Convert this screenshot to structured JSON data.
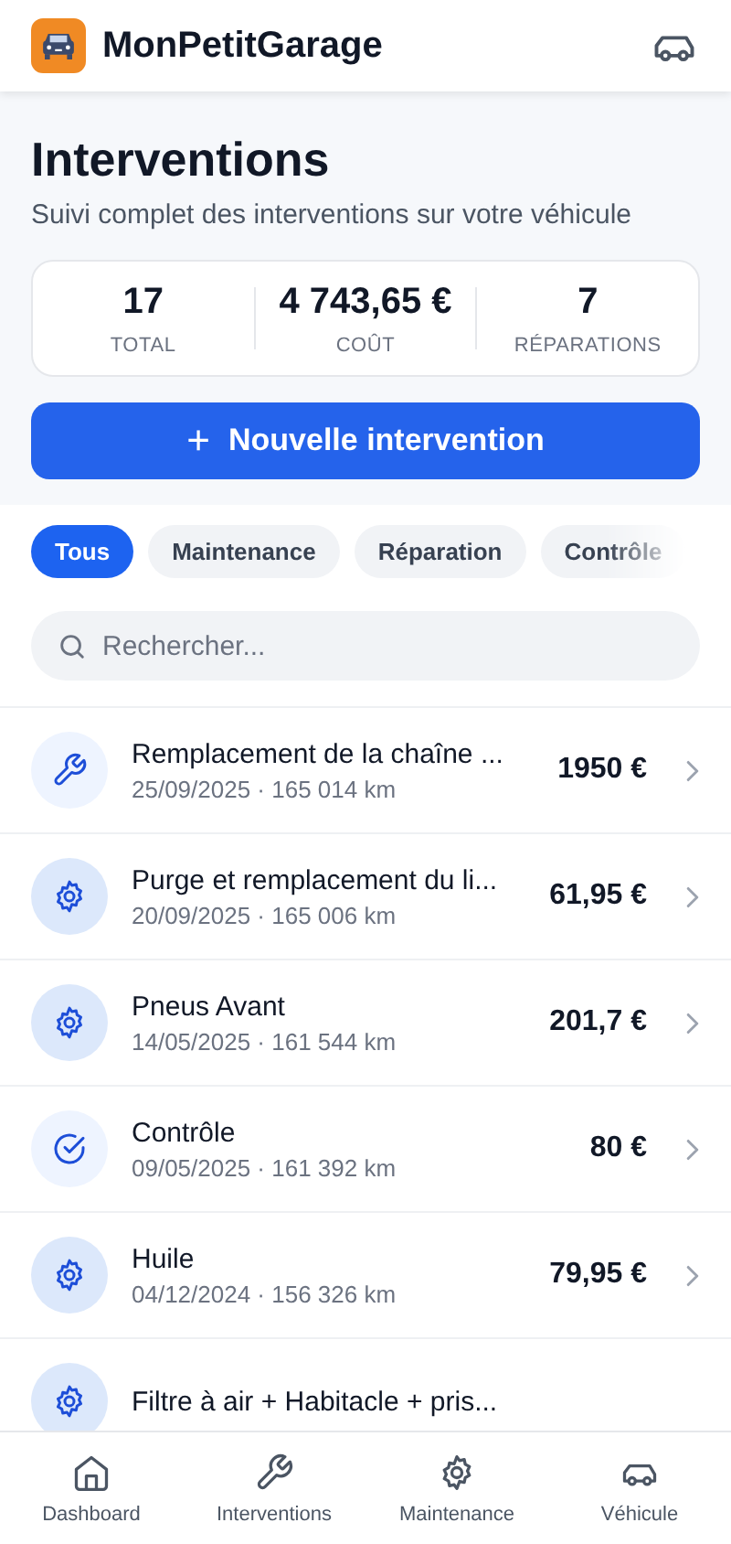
{
  "app": {
    "title": "MonPetitGarage"
  },
  "page": {
    "title": "Interventions",
    "subtitle": "Suivi complet des interventions sur votre véhicule"
  },
  "stats": [
    {
      "value": "17",
      "label": "TOTAL"
    },
    {
      "value": "4 743,65 €",
      "label": "COÛT"
    },
    {
      "value": "7",
      "label": "RÉPARATIONS"
    }
  ],
  "new_button": {
    "icon": "+",
    "label": "Nouvelle intervention"
  },
  "filters": [
    {
      "label": "Tous",
      "selected": true
    },
    {
      "label": "Maintenance",
      "selected": false
    },
    {
      "label": "Réparation",
      "selected": false
    },
    {
      "label": "Contrôle",
      "selected": false
    }
  ],
  "search": {
    "placeholder": "Rechercher..."
  },
  "interventions": [
    {
      "kind": "repair",
      "title": "Remplacement de la chaîne ...",
      "meta": "25/09/2025 · 165 014 km",
      "price": "1950 €"
    },
    {
      "kind": "maintenance",
      "title": "Purge et remplacement du li...",
      "meta": "20/09/2025 · 165 006 km",
      "price": "61,95 €"
    },
    {
      "kind": "maintenance",
      "title": "Pneus Avant",
      "meta": "14/05/2025 · 161 544 km",
      "price": "201,7 €"
    },
    {
      "kind": "inspection",
      "title": "Contrôle",
      "meta": "09/05/2025 · 161 392 km",
      "price": "80 €"
    },
    {
      "kind": "maintenance",
      "title": "Huile",
      "meta": "04/12/2024 · 156 326 km",
      "price": "79,95 €"
    },
    {
      "kind": "maintenance",
      "title": "Filtre à air + Habitacle + pris..."
    }
  ],
  "tab_bar": [
    {
      "kind": "home",
      "label": "Dashboard",
      "selected": false
    },
    {
      "kind": "wrench",
      "label": "Interventions",
      "selected": false
    },
    {
      "kind": "gear",
      "label": "Maintenance",
      "selected": false
    },
    {
      "kind": "car",
      "label": "Véhicule",
      "selected": false
    }
  ]
}
